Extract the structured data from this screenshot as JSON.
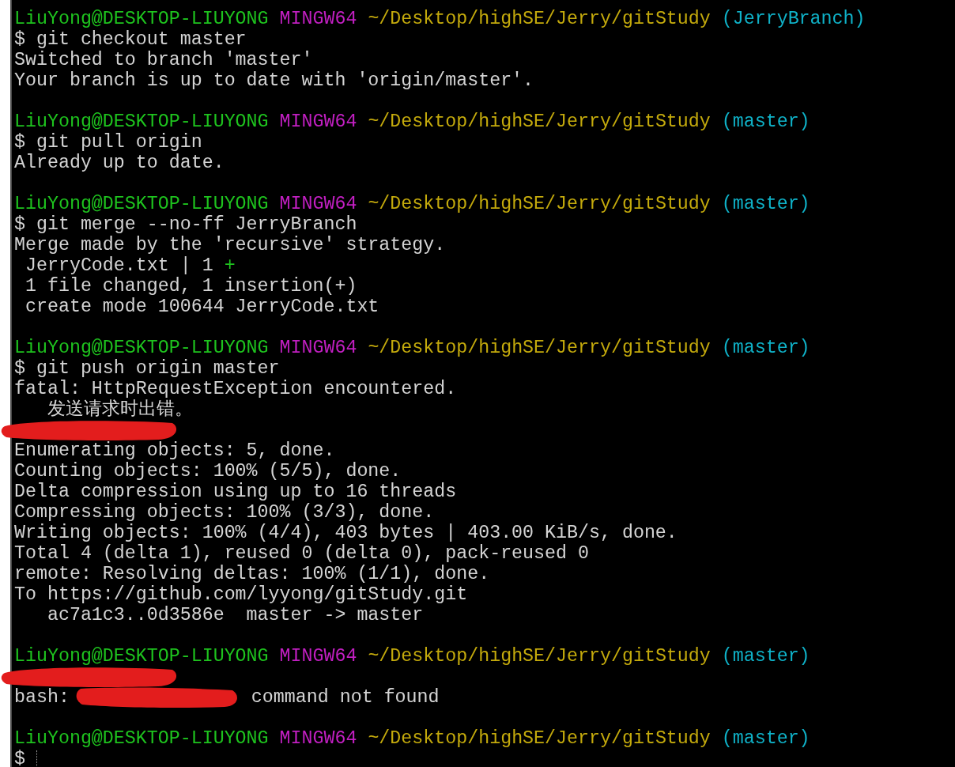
{
  "terminal": {
    "lines": [
      {
        "segments": [
          {
            "kind": "user",
            "text": "LiuYong@DESKTOP-LIUYONG"
          },
          {
            "kind": "shell",
            "text": " MINGW64"
          },
          {
            "kind": "path",
            "text": " ~/Desktop/highSE/Jerry/gitStudy"
          },
          {
            "kind": "branch",
            "text": " (JerryBranch)"
          }
        ]
      },
      {
        "segments": [
          {
            "kind": "command",
            "text": "$ git checkout master"
          }
        ]
      },
      {
        "segments": [
          {
            "kind": "output",
            "text": "Switched to branch 'master'"
          }
        ]
      },
      {
        "segments": [
          {
            "kind": "output",
            "text": "Your branch is up to date with 'origin/master'."
          }
        ]
      },
      {
        "kind": "blank"
      },
      {
        "segments": [
          {
            "kind": "user",
            "text": "LiuYong@DESKTOP-LIUYONG"
          },
          {
            "kind": "shell",
            "text": " MINGW64"
          },
          {
            "kind": "path",
            "text": " ~/Desktop/highSE/Jerry/gitStudy"
          },
          {
            "kind": "branch",
            "text": " (master)"
          }
        ]
      },
      {
        "segments": [
          {
            "kind": "command",
            "text": "$ git pull origin"
          }
        ]
      },
      {
        "segments": [
          {
            "kind": "output",
            "text": "Already up to date."
          }
        ]
      },
      {
        "kind": "blank"
      },
      {
        "segments": [
          {
            "kind": "user",
            "text": "LiuYong@DESKTOP-LIUYONG"
          },
          {
            "kind": "shell",
            "text": " MINGW64"
          },
          {
            "kind": "path",
            "text": " ~/Desktop/highSE/Jerry/gitStudy"
          },
          {
            "kind": "branch",
            "text": " (master)"
          }
        ]
      },
      {
        "segments": [
          {
            "kind": "command",
            "text": "$ git merge --no-ff JerryBranch"
          }
        ]
      },
      {
        "segments": [
          {
            "kind": "output",
            "text": "Merge made by the 'recursive' strategy."
          }
        ]
      },
      {
        "segments": [
          {
            "kind": "output",
            "text": " JerryCode.txt | 1 "
          },
          {
            "kind": "added",
            "text": "+"
          }
        ]
      },
      {
        "segments": [
          {
            "kind": "output",
            "text": " 1 file changed, 1 insertion(+)"
          }
        ]
      },
      {
        "segments": [
          {
            "kind": "output",
            "text": " create mode 100644 JerryCode.txt"
          }
        ]
      },
      {
        "kind": "blank"
      },
      {
        "segments": [
          {
            "kind": "user",
            "text": "LiuYong@DESKTOP-LIUYONG"
          },
          {
            "kind": "shell",
            "text": " MINGW64"
          },
          {
            "kind": "path",
            "text": " ~/Desktop/highSE/Jerry/gitStudy"
          },
          {
            "kind": "branch",
            "text": " (master)"
          }
        ]
      },
      {
        "segments": [
          {
            "kind": "command",
            "text": "$ git push origin master"
          }
        ]
      },
      {
        "segments": [
          {
            "kind": "output",
            "text": "fatal: HttpRequestException encountered."
          }
        ]
      },
      {
        "segments": [
          {
            "kind": "output",
            "text": "   发送请求时出错。"
          }
        ]
      },
      {
        "segments": [
          {
            "kind": "scribble-start"
          }
        ]
      },
      {
        "segments": [
          {
            "kind": "output",
            "text": "Enumerating objects: 5, done."
          }
        ]
      },
      {
        "segments": [
          {
            "kind": "output",
            "text": "Counting objects: 100% (5/5), done."
          }
        ]
      },
      {
        "segments": [
          {
            "kind": "output",
            "text": "Delta compression using up to 16 threads"
          }
        ]
      },
      {
        "segments": [
          {
            "kind": "output",
            "text": "Compressing objects: 100% (3/3), done."
          }
        ]
      },
      {
        "segments": [
          {
            "kind": "output",
            "text": "Writing objects: 100% (4/4), 403 bytes | 403.00 KiB/s, done."
          }
        ]
      },
      {
        "segments": [
          {
            "kind": "output",
            "text": "Total 4 (delta 1), reused 0 (delta 0), pack-reused 0"
          }
        ]
      },
      {
        "segments": [
          {
            "kind": "output",
            "text": "remote: Resolving deltas: 100% (1/1), done."
          }
        ]
      },
      {
        "segments": [
          {
            "kind": "output",
            "text": "To https://github.com/lyyong/gitStudy.git"
          }
        ]
      },
      {
        "segments": [
          {
            "kind": "output",
            "text": "   ac7a1c3..0d3586e  master -> master"
          }
        ]
      },
      {
        "kind": "blank"
      },
      {
        "segments": [
          {
            "kind": "user",
            "text": "LiuYong@DESKTOP-LIUYONG"
          },
          {
            "kind": "shell",
            "text": " MINGW64"
          },
          {
            "kind": "path",
            "text": " ~/Desktop/highSE/Jerry/gitStudy"
          },
          {
            "kind": "branch",
            "text": " (master)"
          }
        ]
      },
      {
        "segments": [
          {
            "kind": "scribble-start"
          }
        ]
      },
      {
        "segments": [
          {
            "kind": "output",
            "text": "bash: "
          },
          {
            "kind": "scribble"
          },
          {
            "kind": "output",
            "text": " command not found"
          }
        ]
      },
      {
        "kind": "blank"
      },
      {
        "segments": [
          {
            "kind": "user",
            "text": "LiuYong@DESKTOP-LIUYONG"
          },
          {
            "kind": "shell",
            "text": " MINGW64"
          },
          {
            "kind": "path",
            "text": " ~/Desktop/highSE/Jerry/gitStudy"
          },
          {
            "kind": "branch",
            "text": " (master)"
          }
        ]
      },
      {
        "segments": [
          {
            "kind": "command",
            "text": "$ "
          },
          {
            "kind": "cursor"
          }
        ]
      }
    ]
  }
}
